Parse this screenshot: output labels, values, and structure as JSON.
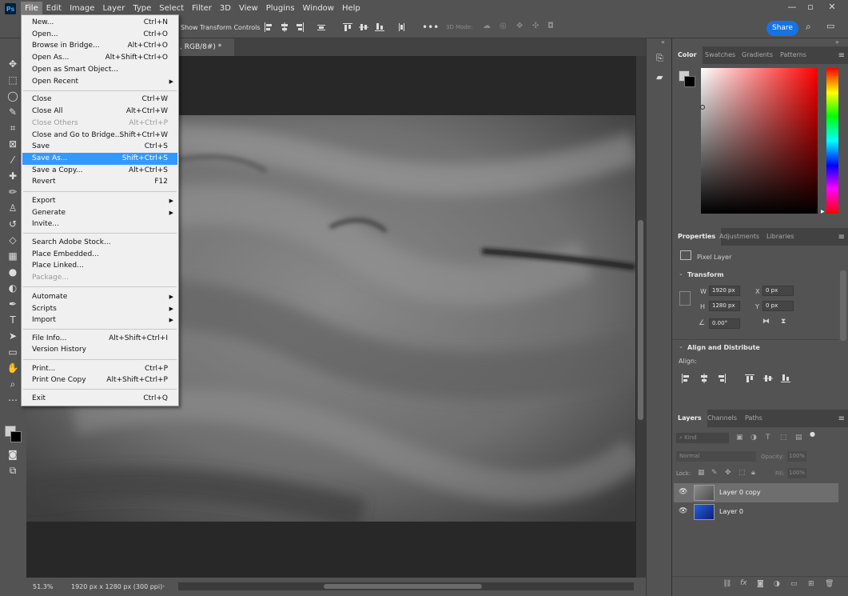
{
  "menubar": {
    "items": [
      "File",
      "Edit",
      "Image",
      "Layer",
      "Type",
      "Select",
      "Filter",
      "3D",
      "View",
      "Plugins",
      "Window",
      "Help"
    ],
    "app_logo": "Ps"
  },
  "options": {
    "transform_label": "Show Transform Controls",
    "mode_label": "3D Mode:",
    "share_label": "Share"
  },
  "document": {
    "tab_title": ", RGB/8#) *"
  },
  "status": {
    "zoom": "51.3%",
    "info": "1920 px x 1280 px (300 ppi)"
  },
  "color_panel": {
    "tabs": [
      "Color",
      "Swatches",
      "Gradients",
      "Patterns"
    ]
  },
  "properties_panel": {
    "tabs": [
      "Properties",
      "Adjustments",
      "Libraries"
    ],
    "layer_type": "Pixel Layer",
    "transform_title": "Transform",
    "w_label": "W",
    "w_value": "1920 px",
    "h_label": "H",
    "h_value": "1280 px",
    "x_label": "X",
    "x_value": "0 px",
    "y_label": "Y",
    "y_value": "0 px",
    "angle_value": "0.00°",
    "align_title": "Align and Distribute",
    "align_label": "Align:"
  },
  "layers_panel": {
    "tabs": [
      "Layers",
      "Channels",
      "Paths"
    ],
    "kind_placeholder": "Kind",
    "blend_mode": "Normal",
    "opacity_label": "Opacity:",
    "opacity_value": "100%",
    "lock_label": "Lock:",
    "fill_label": "Fill:",
    "fill_value": "100%",
    "layers": [
      {
        "name": "Layer 0 copy",
        "selected": true
      },
      {
        "name": "Layer 0",
        "selected": false
      }
    ]
  },
  "file_menu": {
    "items": [
      {
        "label": "New...",
        "shortcut": "Ctrl+N"
      },
      {
        "label": "Open...",
        "shortcut": "Ctrl+O"
      },
      {
        "label": "Browse in Bridge...",
        "shortcut": "Alt+Ctrl+O"
      },
      {
        "label": "Open As...",
        "shortcut": "Alt+Shift+Ctrl+O"
      },
      {
        "label": "Open as Smart Object...",
        "shortcut": ""
      },
      {
        "label": "Open Recent",
        "shortcut": ""
      },
      {
        "label": "Close",
        "shortcut": "Ctrl+W"
      },
      {
        "label": "Close All",
        "shortcut": "Alt+Ctrl+W"
      },
      {
        "label": "Close Others",
        "shortcut": "Alt+Ctrl+P"
      },
      {
        "label": "Close and Go to Bridge...",
        "shortcut": "Shift+Ctrl+W"
      },
      {
        "label": "Save",
        "shortcut": "Ctrl+S"
      },
      {
        "label": "Save As...",
        "shortcut": "Shift+Ctrl+S"
      },
      {
        "label": "Save a Copy...",
        "shortcut": "Alt+Ctrl+S"
      },
      {
        "label": "Revert",
        "shortcut": "F12"
      },
      {
        "label": "Export",
        "shortcut": ""
      },
      {
        "label": "Generate",
        "shortcut": ""
      },
      {
        "label": "Invite...",
        "shortcut": ""
      },
      {
        "label": "Search Adobe Stock...",
        "shortcut": ""
      },
      {
        "label": "Place Embedded...",
        "shortcut": ""
      },
      {
        "label": "Place Linked...",
        "shortcut": ""
      },
      {
        "label": "Package...",
        "shortcut": ""
      },
      {
        "label": "Automate",
        "shortcut": ""
      },
      {
        "label": "Scripts",
        "shortcut": ""
      },
      {
        "label": "Import",
        "shortcut": ""
      },
      {
        "label": "File Info...",
        "shortcut": "Alt+Shift+Ctrl+I"
      },
      {
        "label": "Version History",
        "shortcut": ""
      },
      {
        "label": "Print...",
        "shortcut": "Ctrl+P"
      },
      {
        "label": "Print One Copy",
        "shortcut": "Alt+Shift+Ctrl+P"
      },
      {
        "label": "Exit",
        "shortcut": "Ctrl+Q"
      }
    ]
  }
}
